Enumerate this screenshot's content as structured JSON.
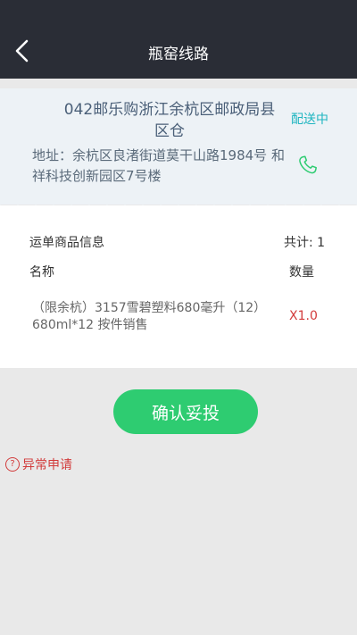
{
  "header": {
    "title": "瓶窑线路",
    "back_icon": "chevron-left-icon"
  },
  "store": {
    "name": "042邮乐购浙江余杭区邮政局县区仓",
    "status": "配送中",
    "address": "地址：余杭区良渚街道莫干山路1984号 和祥科技创新园区7号楼",
    "phone_icon": "phone-icon",
    "status_color": "#1fb5c0"
  },
  "goods": {
    "section_title": "运单商品信息",
    "total": "共计: 1",
    "col_name": "名称",
    "col_qty": "数量",
    "items": [
      {
        "name": "（限余杭）3157雪碧塑料680毫升（12）680ml*12 按件销售",
        "qty": "X1.0"
      }
    ]
  },
  "actions": {
    "confirm_label": "确认妥投",
    "exception_label": "异常申请",
    "confirm_color": "#2ecc71",
    "exception_color": "#d23b3b"
  }
}
